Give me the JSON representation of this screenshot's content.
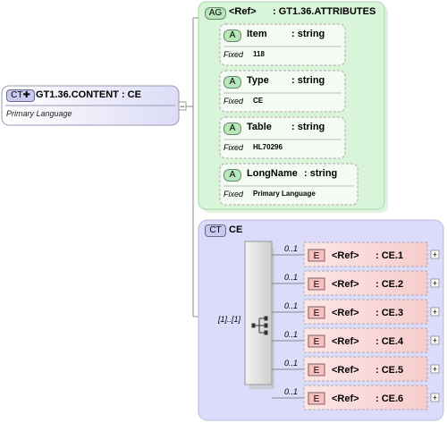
{
  "root": {
    "badge": "CT",
    "name": "GT1.36.CONTENT : CE",
    "annotation": "Primary Language",
    "collapse_symbol": "−"
  },
  "attribute_group": {
    "badge": "AG",
    "ref": "<Ref>",
    "name": ": GT1.36.ATTRIBUTES",
    "attributes": [
      {
        "badge": "A",
        "name": "Item",
        "type": ": string",
        "fixed_label": "Fixed",
        "fixed_value": "118"
      },
      {
        "badge": "A",
        "name": "Type",
        "type": ": string",
        "fixed_label": "Fixed",
        "fixed_value": "CE"
      },
      {
        "badge": "A",
        "name": "Table",
        "type": ": string",
        "fixed_label": "Fixed",
        "fixed_value": "HL70296"
      },
      {
        "badge": "A",
        "name": "LongName",
        "type": ": string",
        "fixed_label": "Fixed",
        "fixed_value": "Primary Language"
      }
    ]
  },
  "complex_type": {
    "badge": "CT",
    "name": "CE",
    "sequence_multiplicity": "[1]..[1]",
    "elements": [
      {
        "badge": "E",
        "ref": "<Ref>",
        "name": ": CE.1",
        "multiplicity": "0..1",
        "expand": "+"
      },
      {
        "badge": "E",
        "ref": "<Ref>",
        "name": ": CE.2",
        "multiplicity": "0..1",
        "expand": "+"
      },
      {
        "badge": "E",
        "ref": "<Ref>",
        "name": ": CE.3",
        "multiplicity": "0..1",
        "expand": "+"
      },
      {
        "badge": "E",
        "ref": "<Ref>",
        "name": ": CE.4",
        "multiplicity": "0..1",
        "expand": "+"
      },
      {
        "badge": "E",
        "ref": "<Ref>",
        "name": ": CE.5",
        "multiplicity": "0..1",
        "expand": "+"
      },
      {
        "badge": "E",
        "ref": "<Ref>",
        "name": ": CE.6",
        "multiplicity": "0..1",
        "expand": "+"
      }
    ]
  },
  "colors": {
    "ag_fill": "#d9f5d9",
    "ct_fill": "#dcdcfa",
    "element_fill": "#fbe0e0",
    "root_fill": "#eeeefc"
  }
}
